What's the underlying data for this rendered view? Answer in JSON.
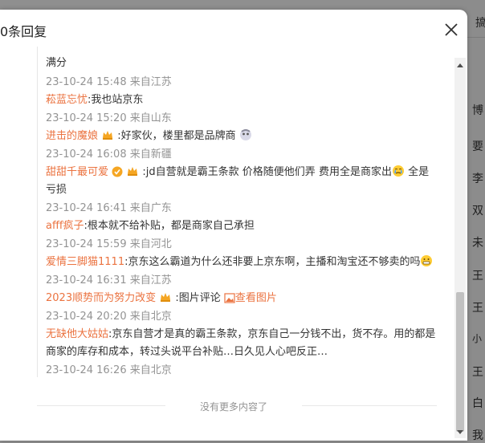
{
  "modal": {
    "title": "0条回复",
    "footer": "没有更多内容了"
  },
  "comments": [
    {
      "text": "满分",
      "meta": "23-10-24 15:48 来自江苏"
    },
    {
      "name": "菘蓝忘忧",
      "text": ":我也站京东",
      "meta": "23-10-24 15:20 来自山东"
    },
    {
      "name": "进击的魔娘",
      "text": " :好家伙，楼里都是品牌商",
      "meta": "23-10-24 16:08 来自新疆"
    },
    {
      "name": "甜甜千最可爱",
      "text_line1": " :jd自营就是霸王条款 价格随便他们弄 费用全是商家出",
      "text_line1b": " 全是",
      "text_line2": "亏损",
      "meta": "23-10-24 16:41 来自广东"
    },
    {
      "name": "afff疯子",
      "text": ":根本就不给补贴，都是商家自己承担",
      "meta": "23-10-24 15:59 来自河北"
    },
    {
      "name": "爱情三脚猫1111",
      "text": ":京东这么霸道为什么还非要上京东啊，主播和淘宝还不够卖的吗",
      "meta": "23-10-24 16:31 来自江苏"
    },
    {
      "name": "2023顺势而为努力改变",
      "text": " :图片评论 ",
      "link": "查看图片",
      "meta": "23-10-24 20:20 来自北京"
    },
    {
      "name": "无缺他大姑姑",
      "text_line1": ":京东自营才是真的霸王条款，京东自己一分钱不出，货不存。用的都是",
      "text_line2": "商家的库存和成本，转过头说平台补贴…日久见人心吧反正…",
      "meta": "23-10-24 16:26 来自北京"
    }
  ],
  "background": {
    "top_item": "搞",
    "items": [
      "博",
      "要",
      "李",
      "双",
      "未",
      "王",
      "王",
      "小",
      "王",
      "白",
      "我"
    ]
  },
  "colors": {
    "username": "#eb7340",
    "meta": "#939393",
    "text": "#333333"
  }
}
